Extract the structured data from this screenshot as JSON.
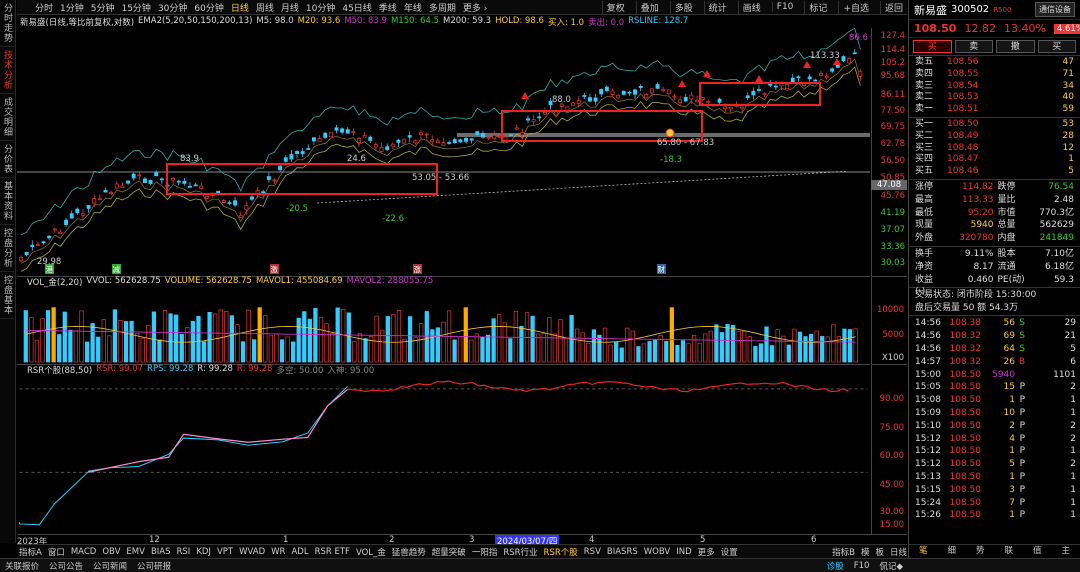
{
  "leftnav": [
    "分时走势",
    "技术分析",
    "成交明细",
    "分价表",
    "基本资料",
    "控盘分析",
    "控盘基本"
  ],
  "leftnav_active": 1,
  "periods": [
    "分时",
    "1分钟",
    "5分钟",
    "15分钟",
    "30分钟",
    "60分钟",
    "日线",
    "周线",
    "月线",
    "10分钟",
    "45日线",
    "季线",
    "年线",
    "多周期",
    "更多 ›"
  ],
  "period_active": 6,
  "toolbar_right": [
    "复权",
    "叠加",
    "多股",
    "统计",
    "画线",
    "F10",
    "标记",
    "+自选",
    "返回"
  ],
  "title": "新易盛(日线,等比前复权,对数)",
  "indicator_line": [
    {
      "t": "EMA2(5,20,50,150,200,13)",
      "c": "#ddd"
    },
    {
      "t": "M5: 98.0",
      "c": "#ddd"
    },
    {
      "t": "M20: 93.6",
      "c": "#fc3"
    },
    {
      "t": "M50: 83.9",
      "c": "#c3c"
    },
    {
      "t": "M150: 64.5",
      "c": "#3c3"
    },
    {
      "t": "M200: 59.3",
      "c": "#ddd"
    },
    {
      "t": "HOLD: 98.6",
      "c": "#fc3"
    },
    {
      "t": "买入: 1.0",
      "c": "#fc3"
    },
    {
      "t": "卖出: 0.0",
      "c": "#c3c"
    },
    {
      "t": "RSLINE: 128.7",
      "c": "#3cf"
    }
  ],
  "price_axis": [
    {
      "v": "127.4",
      "c": "r"
    },
    {
      "v": "114.4",
      "c": "r"
    },
    {
      "v": "105.2",
      "c": "r"
    },
    {
      "v": "95.68",
      "c": "r"
    },
    {
      "v": "86.11",
      "c": "r"
    },
    {
      "v": "77.50",
      "c": "r"
    },
    {
      "v": "69.75",
      "c": "r"
    },
    {
      "v": "62.78",
      "c": "r"
    },
    {
      "v": "56.50",
      "c": "r"
    },
    {
      "v": "50.85",
      "c": "r"
    },
    {
      "v": "45.76",
      "c": "r"
    },
    {
      "v": "41.19",
      "c": "g"
    },
    {
      "v": "37.07",
      "c": "g"
    },
    {
      "v": "33.36",
      "c": "g"
    },
    {
      "v": "30.03",
      "c": "g"
    }
  ],
  "current_price_tag": "47.08",
  "chart_labels": [
    "83.9",
    "24.6",
    "53.05 - 53.66",
    "-20.5",
    "-22.6",
    "88.0",
    "113.33",
    "86.6",
    "65.80 - 67.83",
    "-18.3",
    "29.98"
  ],
  "event_tags": [
    "港",
    "减",
    "激",
    "涨",
    "财"
  ],
  "vol_line": [
    {
      "t": "VOL_金(2,20)",
      "c": "#ddd"
    },
    {
      "t": "VVOL: 562628.75",
      "c": "#ddd"
    },
    {
      "t": "VOLUME: 562628.75",
      "c": "#fc3"
    },
    {
      "t": "MAVOL1: 455084.69",
      "c": "#fc3"
    },
    {
      "t": "MAVOL2: 288055.75",
      "c": "#c3c"
    }
  ],
  "vol_axis": [
    "10000",
    "5000",
    "X100"
  ],
  "rsr_line": [
    {
      "t": "RSR个股(88,50)",
      "c": "#ddd"
    },
    {
      "t": "RSR: 99.07",
      "c": "#e33"
    },
    {
      "t": "RPS: 99.28",
      "c": "#3cf"
    },
    {
      "t": "R: 99.28",
      "c": "#ddd"
    },
    {
      "t": "R: 99.28",
      "c": "#e33"
    },
    {
      "t": "多空: 50.00",
      "c": "#888"
    },
    {
      "t": "入神: 95.00",
      "c": "#888"
    }
  ],
  "rsr_axis": [
    "90.00",
    "75.00",
    "60.00",
    "45.00",
    "30.00",
    "15.00"
  ],
  "dates": [
    "2023年",
    "12",
    "1",
    "2",
    "3",
    "2024/03/07/四",
    "4",
    "5",
    "6"
  ],
  "indicator_tabs": [
    "指标A",
    "窗口",
    "MACD",
    "OBV",
    "EMV",
    "BIAS",
    "RSI",
    "KDJ",
    "VPT",
    "WVAD",
    "WR",
    "ADL",
    "RSR ETF",
    "VOL_金",
    "猛兽趋势",
    "超量突破",
    "一阳指",
    "RSR行业",
    "RSR个股",
    "RSV",
    "BIASRS",
    "WOBV",
    "IND",
    "更多",
    "设置"
  ],
  "indicator_tab_active": 18,
  "tabbar_right": [
    "指标B",
    "模",
    "板",
    "日线"
  ],
  "bottom": [
    "关联报价",
    "公司公告",
    "公司新闻",
    "公司研报"
  ],
  "bottom_right": [
    "诊股",
    "F10",
    "侃记◆"
  ],
  "rp": {
    "name": "新易盛",
    "code": "300502",
    "tag": "R500",
    "badge": "通信设备",
    "price": "108.50",
    "chg": "12.82",
    "pct": "13.40%",
    "pct2": "4.61%",
    "buttons": [
      "买",
      "卖",
      "撤",
      "买"
    ],
    "asks": [
      [
        "卖五",
        "108.56",
        "47"
      ],
      [
        "卖四",
        "108.55",
        "71"
      ],
      [
        "卖三",
        "108.54",
        "34"
      ],
      [
        "卖二",
        "108.53",
        "40"
      ],
      [
        "卖一",
        "108.51",
        "59"
      ]
    ],
    "bids": [
      [
        "买一",
        "108.50",
        "53"
      ],
      [
        "买二",
        "108.49",
        "28"
      ],
      [
        "买三",
        "108.48",
        "12"
      ],
      [
        "买四",
        "108.47",
        "1"
      ],
      [
        "买五",
        "108.46",
        "5"
      ]
    ],
    "stats": [
      [
        "涨停",
        "114.82",
        "跌停",
        "76.54",
        "r",
        "g"
      ],
      [
        "最高",
        "113.33",
        "量比",
        "2.48",
        "r",
        "w"
      ],
      [
        "最低",
        "95.20",
        "市值",
        "770.3亿",
        "r",
        "w"
      ],
      [
        "现量",
        "5940",
        "总量",
        "562629",
        "y",
        "w"
      ],
      [
        "外盘",
        "320780",
        "内盘",
        "241849",
        "r",
        "g"
      ]
    ],
    "stats2": [
      [
        "换手",
        "9.11%",
        "股本",
        "7.10亿",
        "w",
        "w"
      ],
      [
        "净资",
        "8.17",
        "流通",
        "6.18亿",
        "w",
        "w"
      ],
      [
        "收益(-)",
        "0.460",
        "PE(动)",
        "59.3",
        "w",
        "w"
      ]
    ],
    "status": "交易状态: 闭市阶段 15:30:00",
    "afterhours": "盘后交易量 50 额 54.3万",
    "ticks": [
      [
        "14:56",
        "108.38",
        "56",
        "S",
        "29"
      ],
      [
        "14:56",
        "108.32",
        "69",
        "S",
        "21"
      ],
      [
        "14:56",
        "108.32",
        "64",
        "S",
        "5"
      ],
      [
        "14:57",
        "108.32",
        "26",
        "B",
        "6"
      ],
      [
        "15:00",
        "108.50",
        "5940",
        "",
        "1101"
      ],
      [
        "15:05",
        "108.50",
        "15",
        "P",
        "2"
      ],
      [
        "15:08",
        "108.50",
        "1",
        "P",
        "1"
      ],
      [
        "15:09",
        "108.50",
        "10",
        "P",
        "1"
      ],
      [
        "15:10",
        "108.50",
        "2",
        "P",
        "2"
      ],
      [
        "15:12",
        "108.50",
        "4",
        "P",
        "2"
      ],
      [
        "15:12",
        "108.50",
        "1",
        "P",
        "1"
      ],
      [
        "15:12",
        "108.50",
        "5",
        "P",
        "2"
      ],
      [
        "15:13",
        "108.50",
        "1",
        "P",
        "1"
      ],
      [
        "15:15",
        "108.50",
        "3",
        "P",
        "1"
      ],
      [
        "15:24",
        "108.50",
        "7",
        "P",
        "1"
      ],
      [
        "15:26",
        "108.50",
        "1",
        "P",
        "1"
      ]
    ],
    "tabs": [
      "笔",
      "细",
      "势",
      "联",
      "值",
      "主"
    ]
  }
}
